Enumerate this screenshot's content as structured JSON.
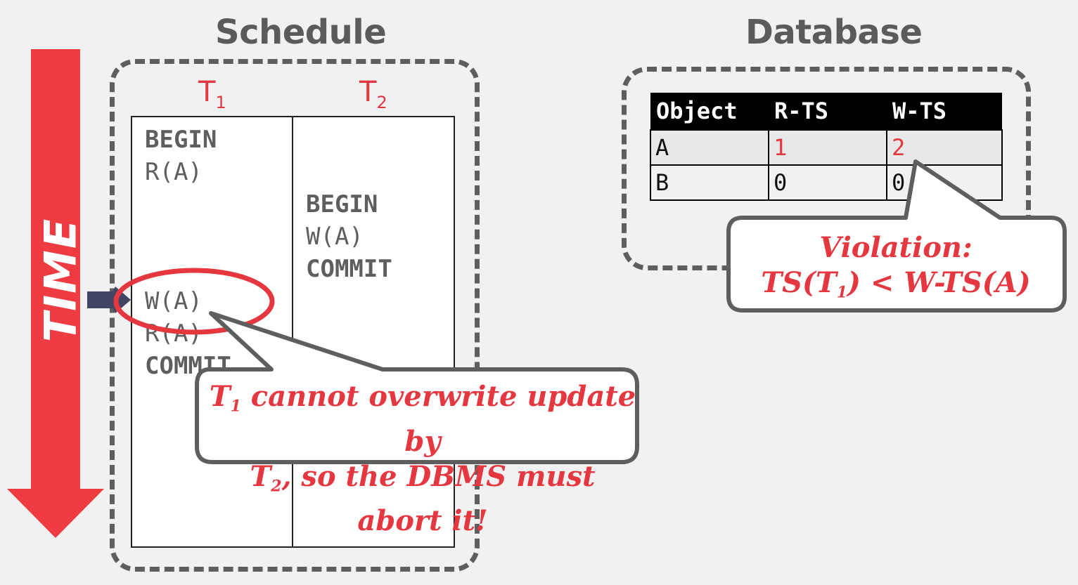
{
  "schedule": {
    "heading": "Schedule",
    "t1": {
      "name": "T",
      "sub": "1"
    },
    "t2": {
      "name": "T",
      "sub": "2"
    },
    "t1_ops": [
      {
        "text": "BEGIN",
        "bold": true
      },
      {
        "text": "R(A)",
        "bold": false
      },
      {
        "text": "W(A)",
        "bold": false
      },
      {
        "text": "R(A)",
        "bold": false
      },
      {
        "text": "COMMIT",
        "bold": true
      }
    ],
    "t2_ops": [
      {
        "text": "BEGIN",
        "bold": true
      },
      {
        "text": "W(A)",
        "bold": false
      },
      {
        "text": "COMMIT",
        "bold": true
      }
    ]
  },
  "time_label": "TIME",
  "database": {
    "heading": "Database",
    "columns": [
      "Object",
      "R-TS",
      "W-TS"
    ],
    "rows": [
      {
        "object": "A",
        "r_ts": "1",
        "w_ts": "2"
      },
      {
        "object": "B",
        "r_ts": "0",
        "w_ts": "0"
      }
    ]
  },
  "callout_violation": {
    "line1": "Violation:",
    "line2_pre": "TS(T",
    "line2_sub": "1",
    "line2_post": ") < W-TS(A)"
  },
  "callout_abort": {
    "line1_t": "T",
    "line1_sub": "1",
    "line1_rest": " cannot overwrite update by",
    "line2_t": "T",
    "line2_sub": "2",
    "line2_rest": ", so the DBMS must abort it!"
  },
  "colors": {
    "accent_red": "#e53740",
    "arrow_red": "#ef3b42",
    "pointer_navy": "#3f4563",
    "outline_gray": "#5e5e5e"
  }
}
